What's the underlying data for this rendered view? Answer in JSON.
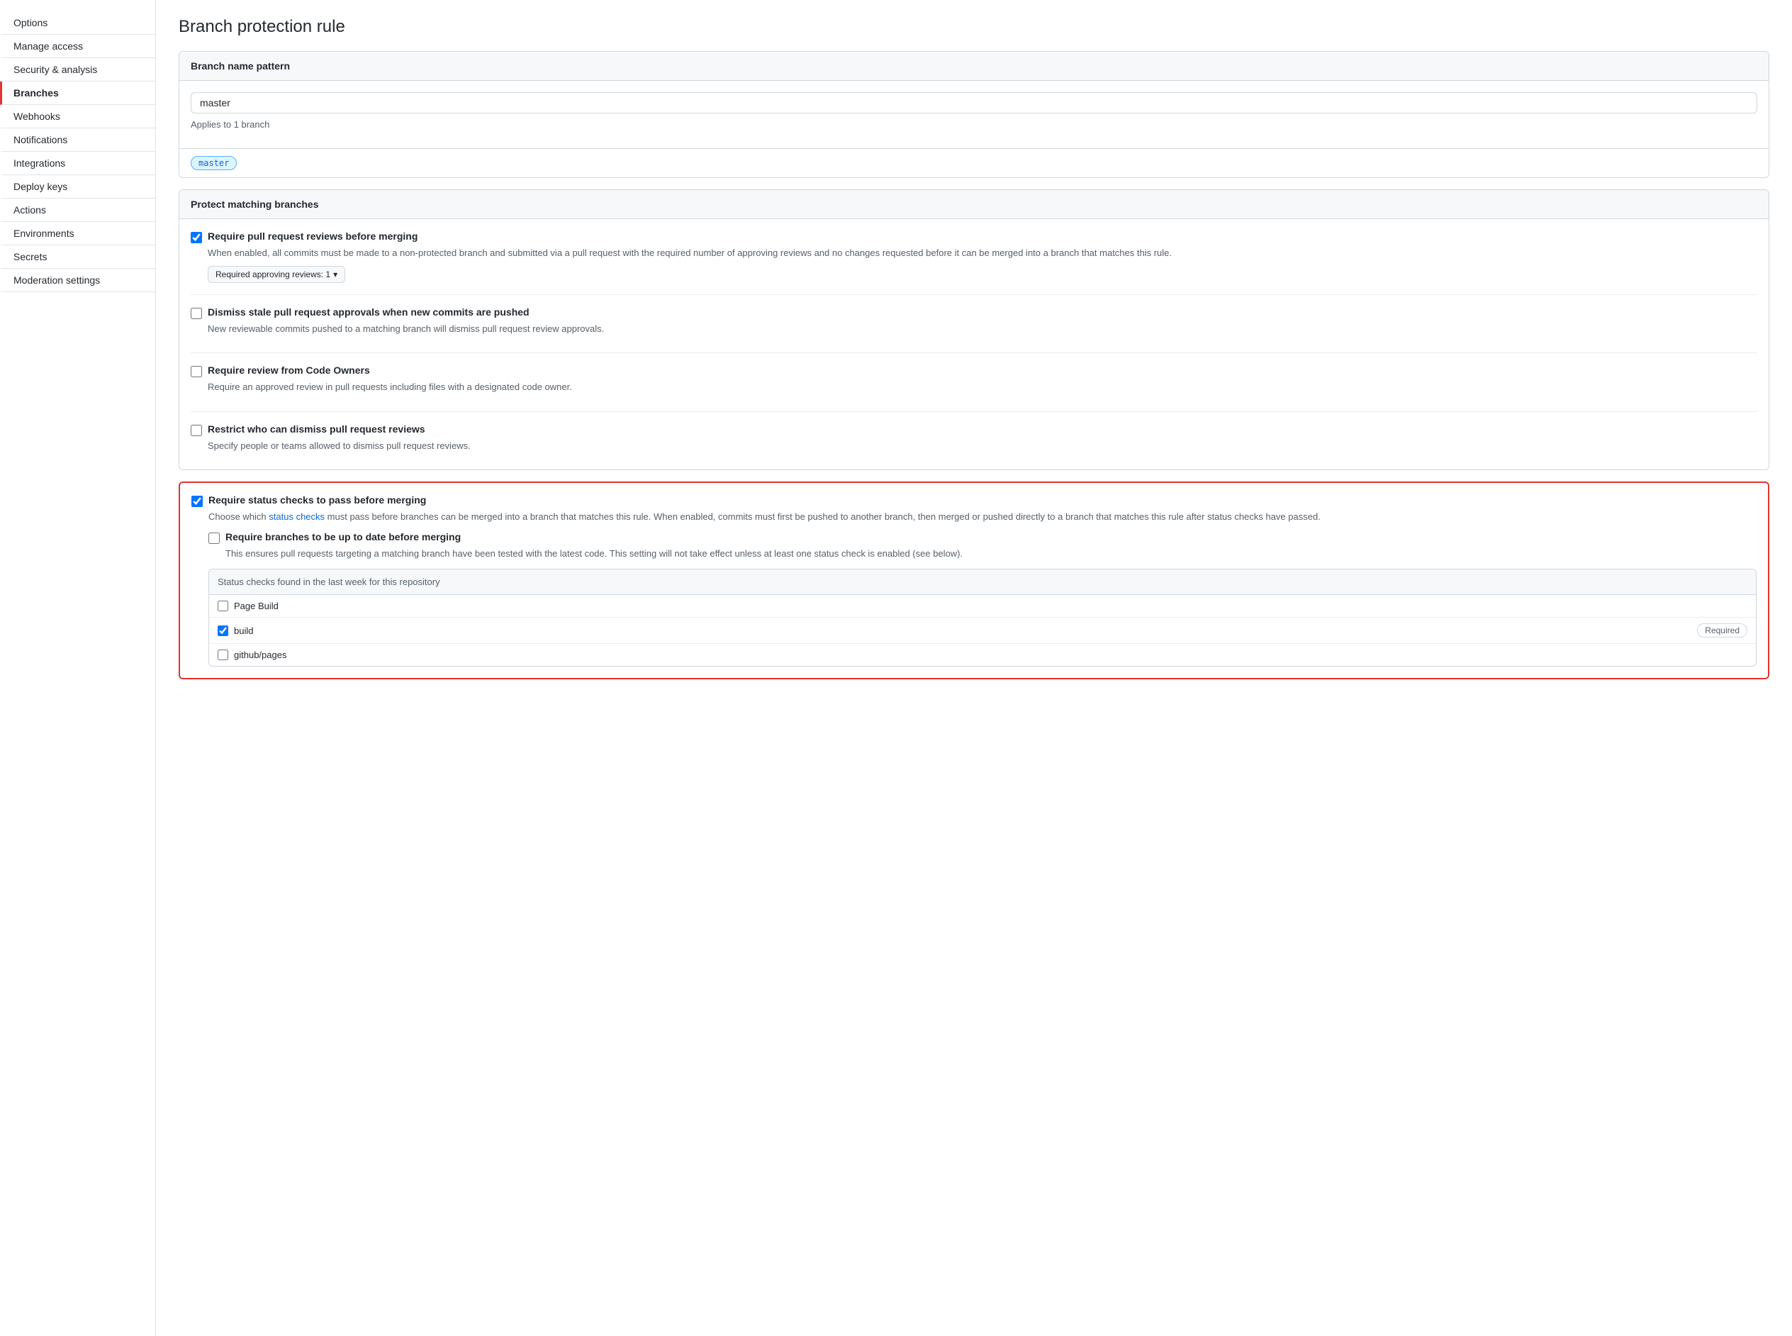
{
  "sidebar": {
    "items": [
      {
        "id": "options",
        "label": "Options",
        "active": false
      },
      {
        "id": "manage-access",
        "label": "Manage access",
        "active": false
      },
      {
        "id": "security-analysis",
        "label": "Security & analysis",
        "active": false
      },
      {
        "id": "branches",
        "label": "Branches",
        "active": true
      },
      {
        "id": "webhooks",
        "label": "Webhooks",
        "active": false
      },
      {
        "id": "notifications",
        "label": "Notifications",
        "active": false
      },
      {
        "id": "integrations",
        "label": "Integrations",
        "active": false
      },
      {
        "id": "deploy-keys",
        "label": "Deploy keys",
        "active": false
      },
      {
        "id": "actions",
        "label": "Actions",
        "active": false
      },
      {
        "id": "environments",
        "label": "Environments",
        "active": false
      },
      {
        "id": "secrets",
        "label": "Secrets",
        "active": false
      },
      {
        "id": "moderation-settings",
        "label": "Moderation settings",
        "active": false
      }
    ]
  },
  "main": {
    "page_title": "Branch protection rule",
    "branch_name_section": {
      "header": "Branch name pattern",
      "input_value": "master",
      "applies_text": "Applies to 1 branch",
      "branch_tag": "master"
    },
    "protect_section": {
      "header": "Protect matching branches",
      "options": [
        {
          "id": "require-pr-reviews",
          "checked": true,
          "label": "Require pull request reviews before merging",
          "desc": "When enabled, all commits must be made to a non-protected branch and submitted via a pull request with the required number of approving reviews and no changes requested before it can be merged into a branch that matches this rule.",
          "has_dropdown": true,
          "dropdown_label": "Required approving reviews: 1"
        },
        {
          "id": "dismiss-stale",
          "checked": false,
          "label": "Dismiss stale pull request approvals when new commits are pushed",
          "desc": "New reviewable commits pushed to a matching branch will dismiss pull request review approvals.",
          "has_dropdown": false
        },
        {
          "id": "require-code-owner-review",
          "checked": false,
          "label": "Require review from Code Owners",
          "desc": "Require an approved review in pull requests including files with a designated code owner.",
          "has_dropdown": false
        },
        {
          "id": "restrict-dismiss-reviews",
          "checked": false,
          "label": "Restrict who can dismiss pull request reviews",
          "desc": "Specify people or teams allowed to dismiss pull request reviews.",
          "has_dropdown": false
        }
      ]
    },
    "status_checks_section": {
      "highlighted": true,
      "main_option": {
        "id": "require-status-checks",
        "checked": true,
        "label": "Require status checks to pass before merging",
        "desc_before_link": "Choose which ",
        "link_text": "status checks",
        "desc_after_link": " must pass before branches can be merged into a branch that matches this rule. When enabled, commits must first be pushed to another branch, then merged or pushed directly to a branch that matches this rule after status checks have passed."
      },
      "sub_option": {
        "id": "require-branches-up-to-date",
        "checked": false,
        "label": "Require branches to be up to date before merging",
        "desc": "This ensures pull requests targeting a matching branch have been tested with the latest code. This setting will not take effect unless at least one status check is enabled (see below)."
      },
      "status_checks_box": {
        "header": "Status checks found in the last week for this repository",
        "items": [
          {
            "id": "page-build",
            "checked": false,
            "label": "Page Build",
            "required": false
          },
          {
            "id": "build",
            "checked": true,
            "label": "build",
            "required": true,
            "required_label": "Required"
          },
          {
            "id": "github-pages",
            "checked": false,
            "label": "github/pages",
            "required": false
          }
        ]
      }
    }
  }
}
